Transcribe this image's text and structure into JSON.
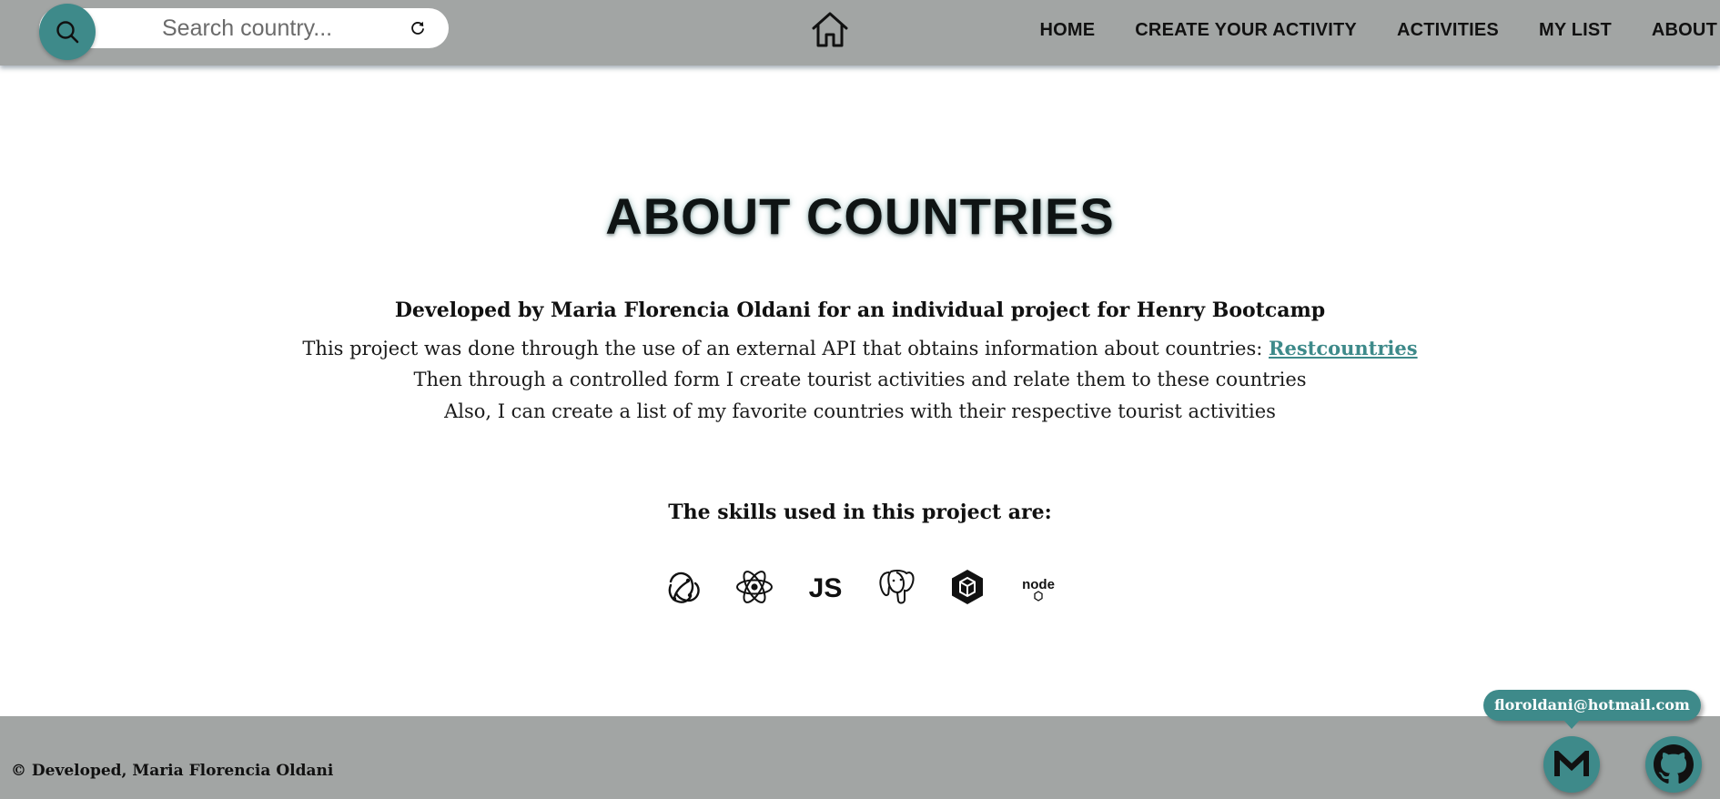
{
  "navbar": {
    "search": {
      "placeholder": "Search country...",
      "value": ""
    },
    "links": [
      "HOME",
      "CREATE YOUR ACTIVITY",
      "ACTIVITIES",
      "MY LIST",
      "ABOUT"
    ]
  },
  "main": {
    "title": "ABOUT COUNTRIES",
    "subtitle": "Developed by Maria Florencia Oldani for an individual project for Henry Bootcamp",
    "desc_line1": "This project was done through the use of an external API that obtains information about countries: ",
    "desc_link": "Restcountries",
    "desc_line2": "Then through a controlled form I create tourist activities and relate them to these countries",
    "desc_line3": "Also, I can create a list of my favorite countries with their respective tourist activities",
    "skills_title": "The skills used in this project are:",
    "skills": [
      "redux-icon",
      "react-icon",
      "javascript-icon",
      "postgresql-icon",
      "sequelize-icon",
      "nodejs-icon"
    ],
    "js_label": "JS",
    "node_label": "node"
  },
  "footer": {
    "copyright": "© Developed, Maria Florencia Oldani",
    "email_tooltip": "floroldani@hotmail.com"
  },
  "colors": {
    "accent": "#3e8a8a",
    "navbar_bg": "#a2a5a4",
    "footer_bg": "#a2a5a4"
  }
}
